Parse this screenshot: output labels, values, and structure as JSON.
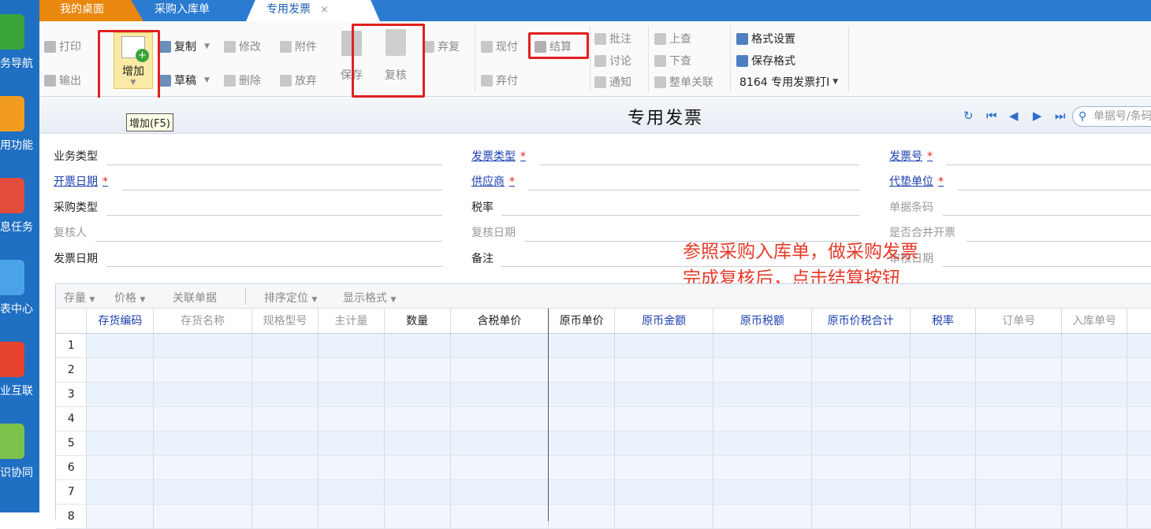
{
  "leftnav": {
    "items": [
      {
        "label": "务导航",
        "color": "#3aa43a"
      },
      {
        "label": "用功能",
        "color": "#f29c1f"
      },
      {
        "label": "息任务",
        "color": "#e24c3c"
      },
      {
        "label": "表中心",
        "color": "#4aa3e8"
      },
      {
        "label": "业互联",
        "color": "#e8432e"
      },
      {
        "label": "识协同",
        "color": "#7cc24a"
      }
    ]
  },
  "tabs": {
    "home": "我的桌面",
    "purchase": "采购入库单",
    "active": "专用发票",
    "close": "×"
  },
  "toolbar": {
    "print": "打印",
    "export": "输出",
    "add": "增加",
    "add_tooltip": "增加(F5)",
    "copy": "复制",
    "draft": "草稿",
    "modify": "修改",
    "delete": "删除",
    "attach": "附件",
    "abandon": "放弃",
    "save": "保存",
    "review": "复核",
    "unreview": "弃复",
    "cashpay": "现付",
    "unpay": "弃付",
    "settle": "结算",
    "annotate": "批注",
    "discuss": "讨论",
    "notify": "通知",
    "up_query": "上查",
    "down_query": "下查",
    "link_all": "整单关联",
    "format_set": "格式设置",
    "save_format": "保存格式",
    "print_template": "8164 专用发票打I"
  },
  "header": {
    "title": "专用发票",
    "search_placeholder": "单据号/条码"
  },
  "form": {
    "business_type": "业务类型",
    "invoice_type": "发票类型",
    "invoice_no": "发票号",
    "invoice_date_open": "开票日期",
    "supplier": "供应商",
    "advance_unit": "代垫单位",
    "purchase_type": "采购类型",
    "tax_rate": "税率",
    "barcode": "单据条码",
    "reviewer": "复核人",
    "review_date": "复核日期",
    "merge_invoice": "是否合并开票",
    "invoice_date": "发票日期",
    "remark": "备注",
    "audit_date": "审核日期",
    "required_mark": "*"
  },
  "annotation": {
    "line1": "参照采购入库单，做采购发票",
    "line2": "完成复核后，点击结算按钮"
  },
  "grid": {
    "tools": [
      "存量",
      "价格",
      "关联单据",
      "排序定位",
      "显示格式"
    ],
    "columns": [
      {
        "label": "",
        "style": "black"
      },
      {
        "label": "存货编码",
        "style": "blue"
      },
      {
        "label": "存货名称",
        "style": "gray"
      },
      {
        "label": "规格型号",
        "style": "gray"
      },
      {
        "label": "主计量",
        "style": "gray"
      },
      {
        "label": "数量",
        "style": "black"
      },
      {
        "label": "含税单价",
        "style": "black"
      },
      {
        "label": "原币单价",
        "style": "black"
      },
      {
        "label": "原币金额",
        "style": "blue"
      },
      {
        "label": "原币税额",
        "style": "blue"
      },
      {
        "label": "原币价税合计",
        "style": "blue"
      },
      {
        "label": "税率",
        "style": "blue"
      },
      {
        "label": "订单号",
        "style": "gray"
      },
      {
        "label": "入库单号",
        "style": "gray"
      },
      {
        "label": "",
        "style": "gray"
      }
    ],
    "rows": [
      "1",
      "2",
      "3",
      "4",
      "5",
      "6",
      "7",
      "8"
    ]
  }
}
